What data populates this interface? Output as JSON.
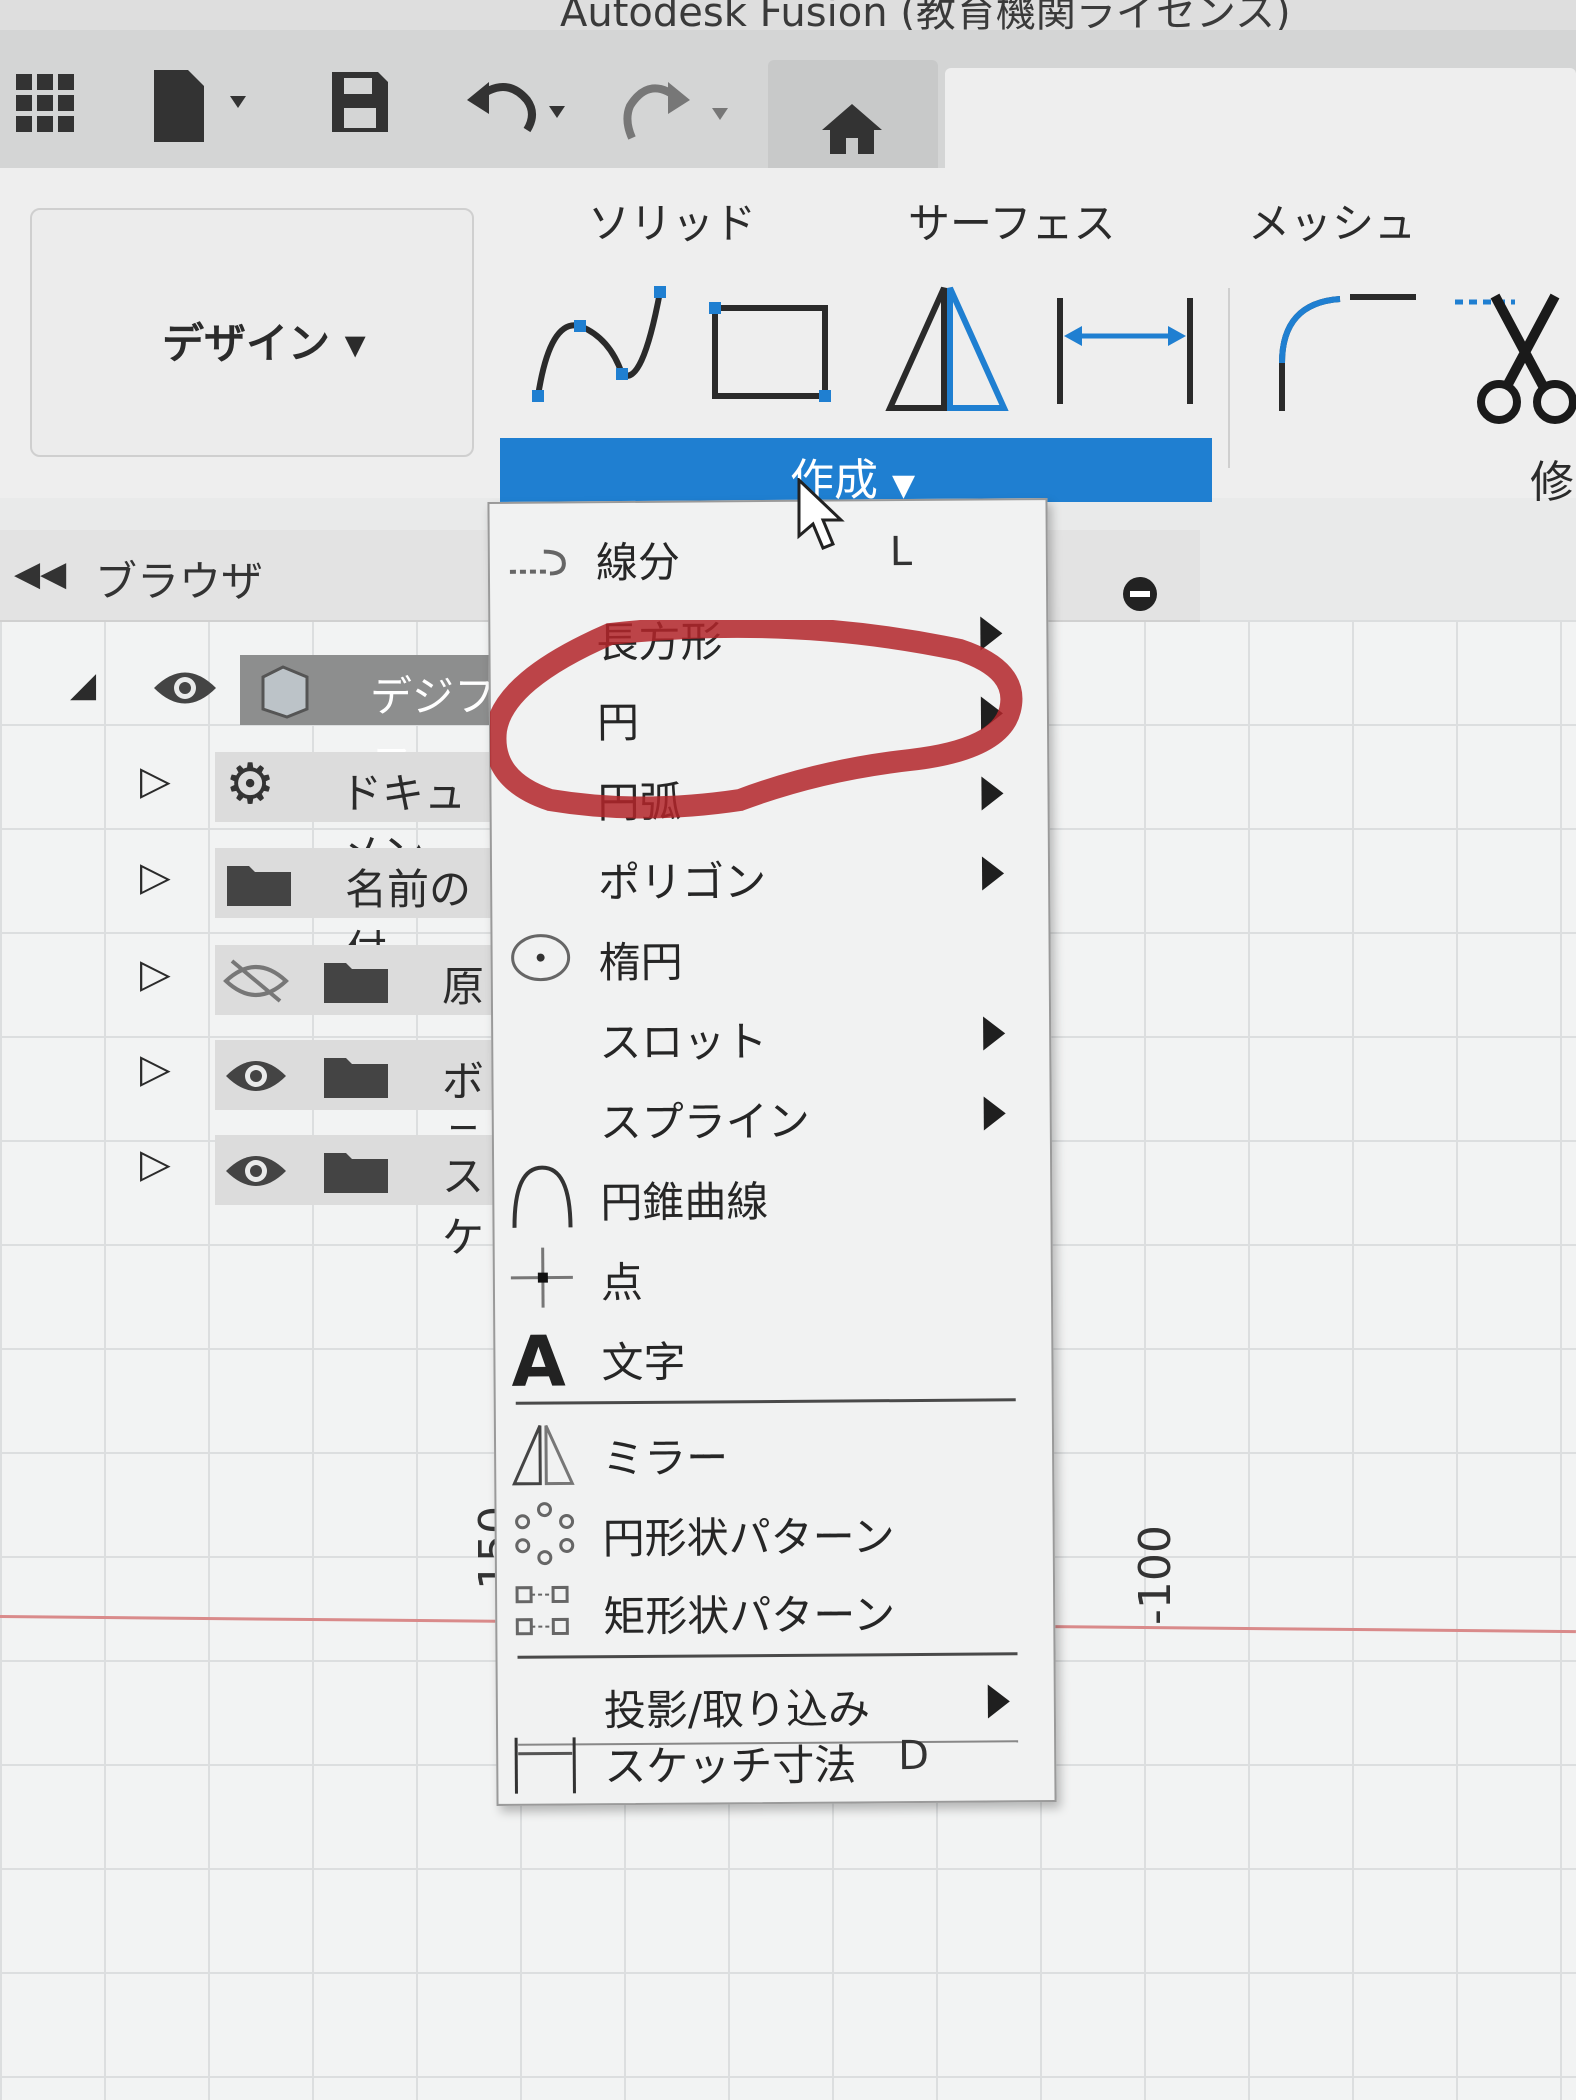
{
  "window": {
    "title": "Autodesk Fusion (教育機関ライセンス)"
  },
  "ribbon": {
    "workspace_label": "デザイン",
    "tabs": [
      "ソリッド",
      "サーフェス",
      "メッシュ"
    ],
    "create_label": "作成",
    "modify_partial": "修"
  },
  "browser": {
    "title": "ブラウザ",
    "rows": [
      {
        "label": "デジファ"
      },
      {
        "label": "ドキュメン"
      },
      {
        "label": "名前の付"
      },
      {
        "label": "原"
      },
      {
        "label": "ボテ"
      },
      {
        "label": "スケ"
      }
    ]
  },
  "canvas": {
    "axis_labels": [
      "150",
      "-100"
    ]
  },
  "menu": {
    "items": [
      {
        "label": "線分",
        "shortcut": "L",
        "submenu": false,
        "icon": "line-icon"
      },
      {
        "label": "長方形",
        "shortcut": "",
        "submenu": true,
        "icon": ""
      },
      {
        "label": "円",
        "shortcut": "",
        "submenu": true,
        "icon": ""
      },
      {
        "label": "円弧",
        "shortcut": "",
        "submenu": true,
        "icon": ""
      },
      {
        "label": "ポリゴン",
        "shortcut": "",
        "submenu": true,
        "icon": ""
      },
      {
        "label": "楕円",
        "shortcut": "",
        "submenu": false,
        "icon": "ellipse-icon"
      },
      {
        "label": "スロット",
        "shortcut": "",
        "submenu": true,
        "icon": ""
      },
      {
        "label": "スプライン",
        "shortcut": "",
        "submenu": true,
        "icon": ""
      },
      {
        "label": "円錐曲線",
        "shortcut": "",
        "submenu": false,
        "icon": "conic-curve-icon"
      },
      {
        "label": "点",
        "shortcut": "",
        "submenu": false,
        "icon": "point-icon"
      },
      {
        "label": "文字",
        "shortcut": "",
        "submenu": false,
        "icon": "text-icon"
      },
      {
        "label": "ミラー",
        "shortcut": "",
        "submenu": false,
        "icon": "mirror-icon"
      },
      {
        "label": "円形状パターン",
        "shortcut": "",
        "submenu": false,
        "icon": "circular-pattern-icon"
      },
      {
        "label": "矩形状パターン",
        "shortcut": "",
        "submenu": false,
        "icon": "rectangular-pattern-icon"
      },
      {
        "label": "投影/取り込み",
        "shortcut": "",
        "submenu": true,
        "icon": ""
      },
      {
        "label": "スケッチ寸法",
        "shortcut": "D",
        "submenu": false,
        "icon": "sketch-dimension-icon"
      }
    ]
  },
  "colors": {
    "accent": "#1f7fd1",
    "highlight_marker": "#b3262a"
  }
}
